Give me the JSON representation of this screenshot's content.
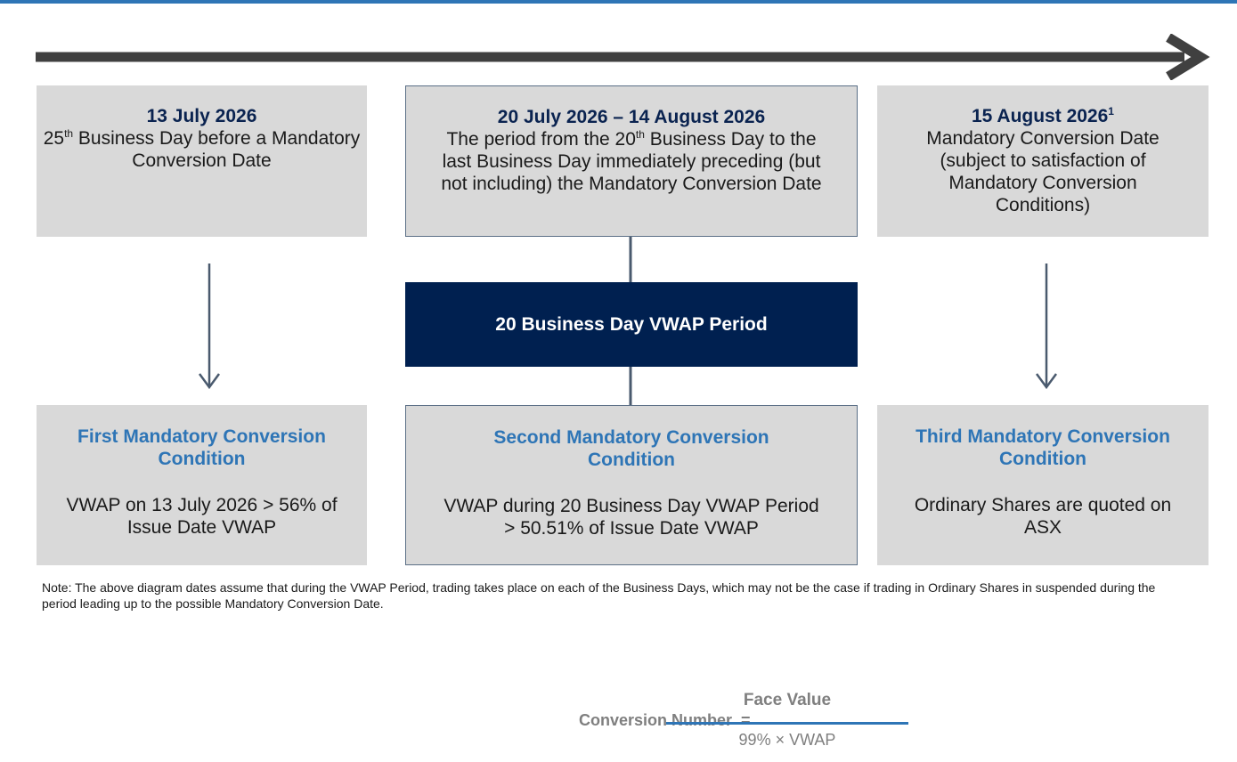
{
  "colors": {
    "rule": "#2e75b6",
    "arrow": "#404040",
    "connector": "#4a5a6e",
    "box_fill": "#d9d9d9",
    "date_title": "#0a2350",
    "cond_title": "#2e75b6",
    "vwap_fill": "#002050",
    "formula_bar": "#2e75b6"
  },
  "dates": [
    {
      "title": "13 July 2026",
      "sup_prefix": "25",
      "sup": "th",
      "desc": " Business Day before a Mandatory Conversion Date"
    },
    {
      "title": "20 July 2026 – 14 August 2026",
      "desc_a": "The period from the 20",
      "sup": "th",
      "desc_b": " Business Day to the last Business Day immediately preceding (but not including) the Mandatory Conversion Date"
    },
    {
      "title": "15 August 2026",
      "title_sup": "1",
      "desc": "Mandatory Conversion Date (subject to satisfaction of Mandatory Conversion Conditions)"
    }
  ],
  "vwap_period": "20 Business Day VWAP Period",
  "conditions": [
    {
      "title": "First Mandatory Conversion Condition",
      "body": "VWAP on 13 July 2026 > 56% of Issue Date VWAP"
    },
    {
      "title": "Second Mandatory Conversion Condition",
      "body": "VWAP during 20 Business Day VWAP Period > 50.51% of Issue Date VWAP"
    },
    {
      "title": "Third Mandatory Conversion Condition",
      "body": "Ordinary Shares are quoted on ASX"
    }
  ],
  "note": "Note: The above diagram dates assume that during the VWAP Period, trading takes place on each of the Business Days, which may not be the case if trading in Ordinary Shares in suspended during the period leading up to the possible Mandatory Conversion Date.",
  "formula": {
    "label": "Conversion Number",
    "equals": "=",
    "numerator": "Face Value",
    "denominator": "99% × VWAP"
  }
}
